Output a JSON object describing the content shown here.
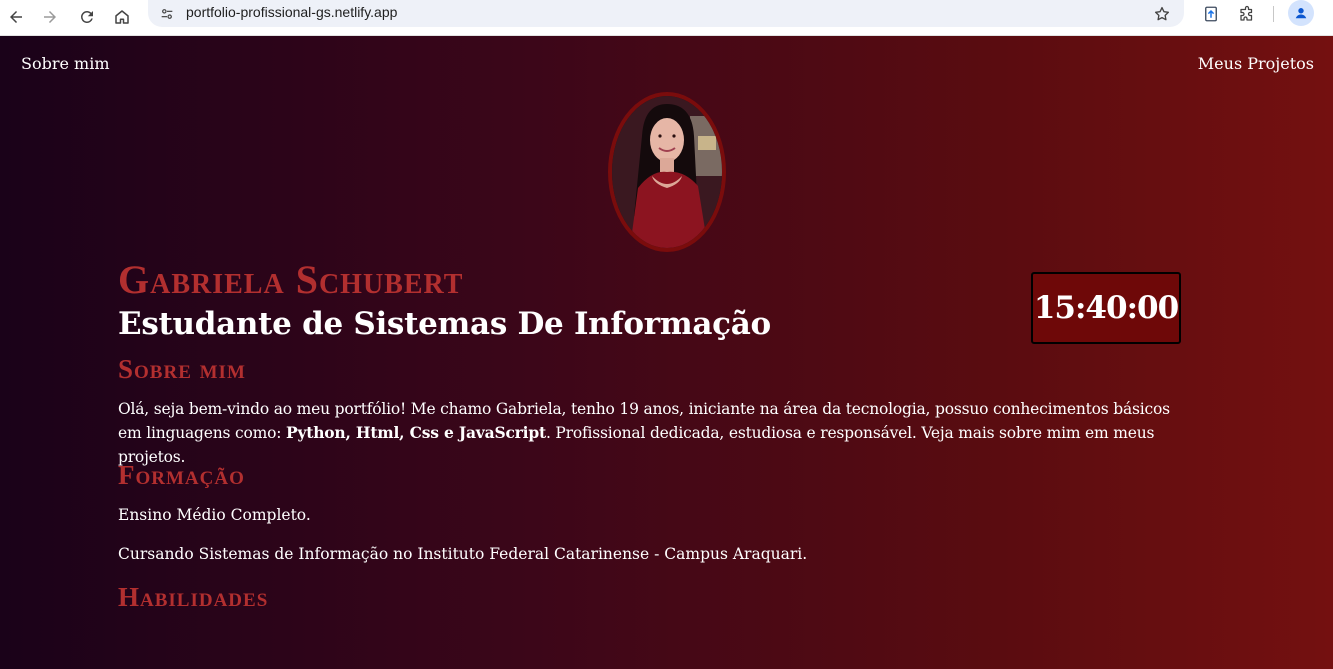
{
  "browser": {
    "url": "portfolio-profissional-gs.netlify.app",
    "icons": [
      "back-icon",
      "forward-icon",
      "reload-icon",
      "home-icon",
      "site-info-icon",
      "star-icon",
      "extension-upload-icon",
      "puzzle-icon",
      "profile-icon"
    ]
  },
  "nav": {
    "left_label": "Sobre mim",
    "right_label": "Meus Projetos"
  },
  "header": {
    "name": "Gabriela Schubert",
    "subtitle": "Estudante de Sistemas De Informação",
    "clock": "15:40:00"
  },
  "about": {
    "title": "Sobre mim",
    "text_before": "Olá, seja bem-vindo ao meu portfólio! Me chamo Gabriela, tenho 19 anos, iniciante na área da tecnologia, possuo conhecimentos básicos em linguagens como: ",
    "text_bold": "Python, Html, Css e JavaScript",
    "text_after": ". Profissional dedicada, estudiosa e responsável. Veja mais sobre mim em meus projetos."
  },
  "education": {
    "title": "Formação",
    "items": [
      "Ensino Médio Completo.",
      "Cursando Sistemas de Informação no Instituto Federal Catarinense - Campus Araquari."
    ]
  },
  "skills": {
    "title": "Habilidades"
  },
  "colors": {
    "accent": "#b22f2f",
    "clock_bg": "#6e0808",
    "gradient_start": "#1a0219",
    "gradient_end": "#741010"
  }
}
